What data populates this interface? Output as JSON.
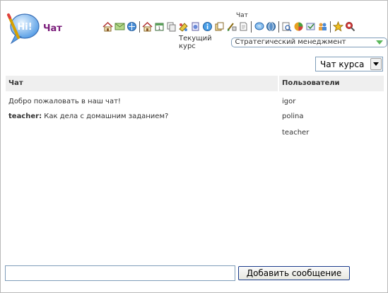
{
  "header": {
    "app_title": "Чат",
    "toolbar_caption": "Чат",
    "toolbar_icons": [
      "home-icon",
      "mail-icon",
      "globe-icon",
      "separator",
      "home-icon",
      "calendar-icon",
      "copy-icon",
      "paint-icon",
      "notepad-icon",
      "info-icon",
      "files-icon",
      "brush-icon",
      "page-icon",
      "separator",
      "chat-icon",
      "web-icon",
      "separator",
      "search-doc-icon",
      "chart-icon",
      "check-icon",
      "users-icon",
      "separator",
      "star-icon",
      "find-icon"
    ],
    "course_label": "Текущий курс",
    "course_value": "Стратегический менеджмент"
  },
  "chat_type": {
    "value": "Чат курса"
  },
  "table": {
    "chat_header": "Чат",
    "users_header": "Пользователи",
    "messages": [
      {
        "author": "",
        "text": "Добро пожаловать в наш чат!"
      },
      {
        "author": "teacher:",
        "text": "Как дела с домашним заданием?"
      }
    ],
    "users": [
      "igor",
      "polina",
      "teacher"
    ]
  },
  "composer": {
    "input_value": "",
    "send_label": "Добавить сообщение"
  },
  "colors": {
    "title": "#7a1c7a",
    "header_bg": "#efefef",
    "border": "#b9b9b9"
  }
}
